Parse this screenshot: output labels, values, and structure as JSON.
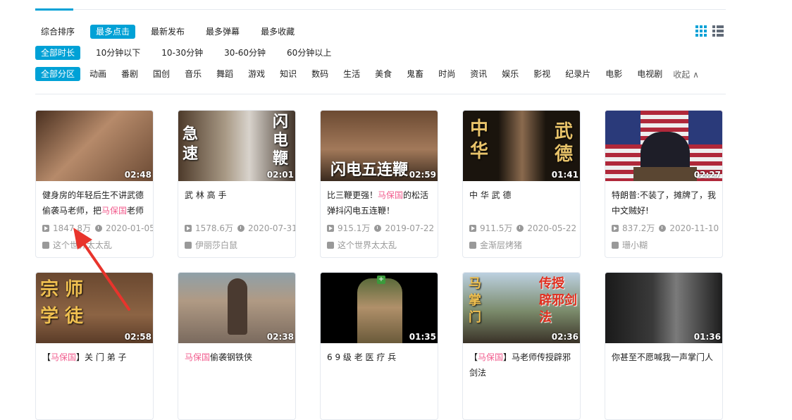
{
  "sort_options": [
    "综合排序",
    "最多点击",
    "最新发布",
    "最多弹幕",
    "最多收藏"
  ],
  "duration_options": [
    "全部时长",
    "10分钟以下",
    "10-30分钟",
    "30-60分钟",
    "60分钟以上"
  ],
  "zone_options": [
    "全部分区",
    "动画",
    "番剧",
    "国创",
    "音乐",
    "舞蹈",
    "游戏",
    "知识",
    "数码",
    "生活",
    "美食",
    "鬼畜",
    "时尚",
    "资讯",
    "娱乐",
    "影视",
    "纪录片",
    "电影",
    "电视剧"
  ],
  "collapse_label": "收起",
  "collapse_glyph": "∧",
  "videos": [
    {
      "duration": "02:48",
      "title_pre": "健身房的年轻后生不讲武德偷袭马老师，把",
      "title_hl": "马保国",
      "title_post": "老师",
      "views": "1847.8万",
      "date": "2020-01-05",
      "uploader": "这个世界太太乱",
      "overlay": [
        "",
        ""
      ]
    },
    {
      "duration": "02:01",
      "title_pre": "武 林 高 手",
      "title_hl": "",
      "title_post": "",
      "views": "1578.6万",
      "date": "2020-07-31",
      "uploader": "伊丽莎白鼠",
      "overlay": [
        "急速",
        "闪电鞭"
      ]
    },
    {
      "duration": "02:59",
      "title_pre": "比三鞭更强！",
      "title_hl": "马保国",
      "title_post": "的松活弹抖闪电五连鞭！",
      "views": "915.1万",
      "date": "2019-07-22",
      "uploader": "这个世界太太乱",
      "overlay": [
        "闪电五连鞭",
        ""
      ]
    },
    {
      "duration": "01:41",
      "title_pre": "中 华 武 德",
      "title_hl": "",
      "title_post": "",
      "views": "911.5万",
      "date": "2020-05-22",
      "uploader": "金渐层烤猪",
      "overlay": [
        "中华",
        "武德"
      ]
    },
    {
      "duration": "02:27",
      "title_pre": "特朗普:不装了，摊牌了，我中文贼好!",
      "title_hl": "",
      "title_post": "",
      "views": "837.2万",
      "date": "2020-11-10",
      "uploader": "珊小糊",
      "overlay": [
        "",
        ""
      ]
    },
    {
      "duration": "02:58",
      "title_pre": "【",
      "title_hl": "马保国",
      "title_post": "】关 门 弟 子",
      "views": "",
      "date": "",
      "uploader": "",
      "overlay": [
        "宗 师",
        "学 徒"
      ]
    },
    {
      "duration": "02:38",
      "title_pre": "",
      "title_hl": "马保国",
      "title_post": "偷袭钢铁侠",
      "views": "",
      "date": "",
      "uploader": "",
      "overlay": [
        "",
        ""
      ]
    },
    {
      "duration": "01:35",
      "title_pre": "6 9 级 老 医 疗 兵",
      "title_hl": "",
      "title_post": "",
      "views": "",
      "date": "",
      "uploader": "",
      "overlay": [
        "",
        ""
      ]
    },
    {
      "duration": "02:36",
      "title_pre": "【",
      "title_hl": "马保国",
      "title_post": "】马老师传授辟邪剑法",
      "views": "",
      "date": "",
      "uploader": "",
      "overlay": [
        "马掌门",
        "传授 辟邪剑法"
      ]
    },
    {
      "duration": "01:36",
      "title_pre": "你甚至不愿喊我一声掌门人",
      "title_hl": "",
      "title_post": "",
      "views": "",
      "date": "",
      "uploader": "",
      "overlay": [
        "",
        ""
      ]
    }
  ],
  "colors": {
    "accent": "#00a1d6",
    "highlight": "#f25d8e",
    "arrow": "#e8342c"
  }
}
